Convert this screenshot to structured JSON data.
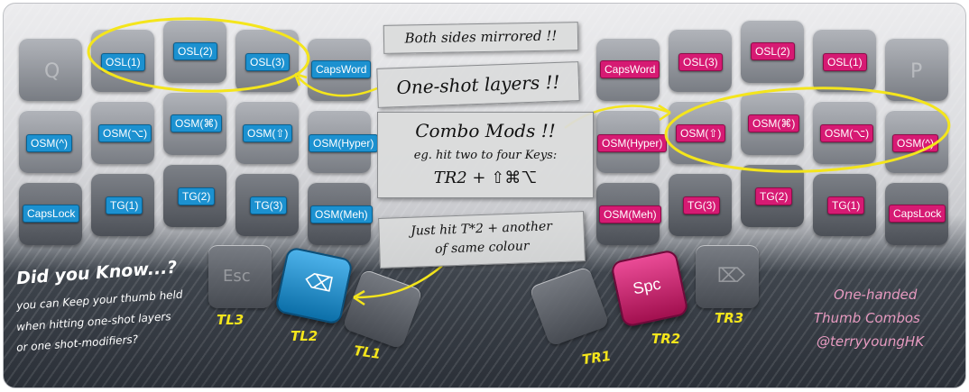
{
  "left": {
    "row1": [
      "OSL(1)",
      "OSL(2)",
      "OSL(3)",
      "CapsWord"
    ],
    "row2": [
      "OSM(^)",
      "OSM(⌥)",
      "OSM(⌘)",
      "OSM(⇧)",
      "OSM(Hyper)"
    ],
    "row3": [
      "CapsLock",
      "TG(1)",
      "TG(2)",
      "TG(3)",
      "OSM(Meh)"
    ],
    "ghost_q": "Q",
    "ghost_esc": "Esc",
    "thumb_icon": "⌫"
  },
  "right": {
    "row1": [
      "CapsWord",
      "OSL(3)",
      "OSL(2)",
      "OSL(1)"
    ],
    "row2": [
      "OSM(Hyper)",
      "OSM(⇧)",
      "OSM(⌘)",
      "OSM(⌥)",
      "OSM(^)"
    ],
    "row3": [
      "OSM(Meh)",
      "TG(3)",
      "TG(2)",
      "TG(1)",
      "CapsLock"
    ],
    "ghost_p": "P",
    "ghost_del": "⌦",
    "spc": "Spc"
  },
  "notes": {
    "mirrored": "Both sides mirrored !!",
    "oneshot": "One-shot layers !!",
    "combo_title": "Combo Mods !!",
    "combo_line1": "eg. hit two to four Keys:",
    "combo_line2": "TR2 + ⇧⌘⌥",
    "just_line1": "Just hit T*2 + another",
    "just_line2": "of same colour"
  },
  "thumbs": {
    "tl3": "TL3",
    "tl2": "TL2",
    "tl1": "TL1",
    "tr1": "TR1",
    "tr2": "TR2",
    "tr3": "TR3"
  },
  "didyouknow": {
    "title": "Did you Know...?",
    "line1": "you can Keep your thumb held",
    "line2": "when hitting one-shot layers",
    "line3": "or one shot-modifiers?"
  },
  "credit": {
    "line1": "One-handed",
    "line2": "Thumb Combos",
    "line3": "@terryyoungHK"
  },
  "colors": {
    "blue": "#1c91d0",
    "magenta": "#d61a73",
    "highlight": "#f4e51c"
  }
}
